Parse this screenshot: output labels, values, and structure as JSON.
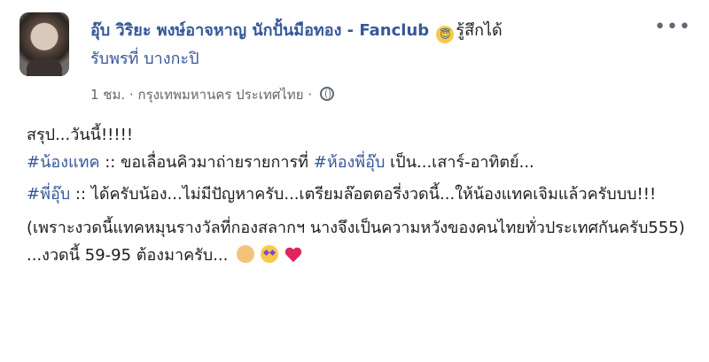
{
  "post": {
    "author": "อุ๊บ วิริยะ พงษ์อาจหาญ นักปั้นมือทอง - Fanclub",
    "feeling_emoji": "smiling-face-with-halo",
    "feeling": "รู้สึกได้",
    "feeling_line2": "รับพรที่ บางกะปิ",
    "time": "1 ชม.",
    "separator": "·",
    "location": "กรุงเทพมหานคร ประเทศไทย",
    "separator2": "·",
    "privacy_icon": "globe-icon",
    "more_label": "•••"
  },
  "content": {
    "line1": "สรุป...วันนี้!!!!!",
    "p2_tag": "#น้องแทค",
    "p2_text": " :: ขอเลื่อนคิวมาถ่ายรายการที่ ",
    "p2_tag2": "#ห้องพี่อุ๊บ",
    "p2_text2": " เป็น...เสาร์-อาทิตย์...",
    "p3_tag": "#พี่อุ๊บ",
    "p3_text": " :: ได้ครับน้อง...ไม่มีปัญหาครับ...เตรียมล๊อตตอรี่งวดนี้...ให้น้องแทคเจิมแล้วครับบบ!!!",
    "p4_line1": "(เพราะงวดนี้แทคหมุนรางวัลที่กองสลากฯ นางจึงเป็นความหวังของคนไทยทั่วประเทศกันครับ555)",
    "p4_line2": "...งวดนี้ 59-95 ต้องมาครับ...",
    "emojis": [
      "folded-hands",
      "star-struck",
      "red-heart"
    ]
  }
}
